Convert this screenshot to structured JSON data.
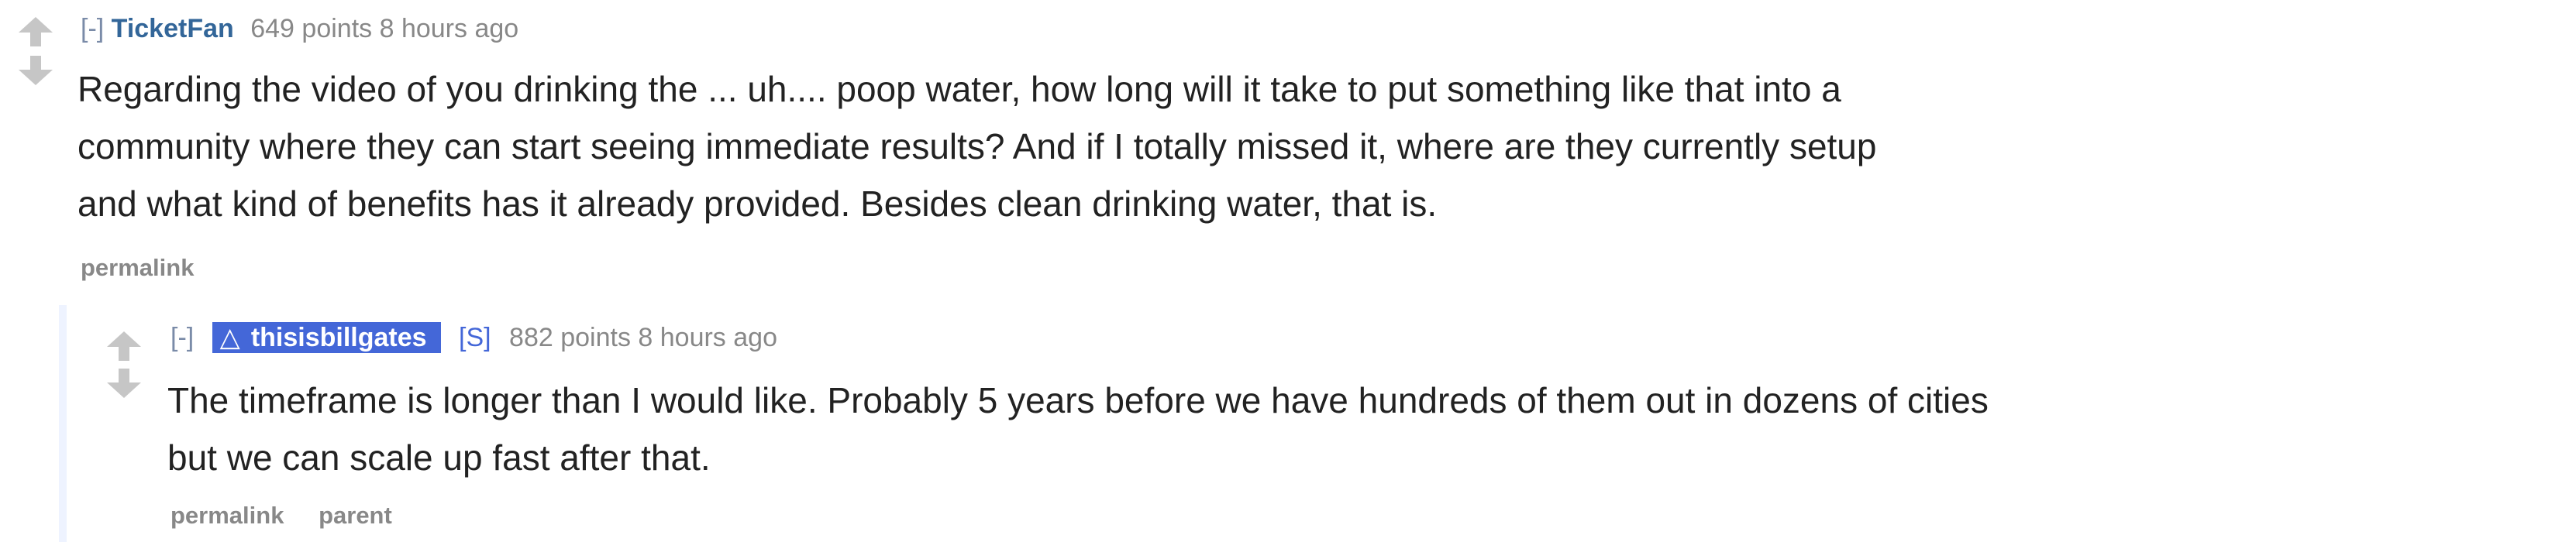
{
  "comment": {
    "expand": "[-]",
    "author": "TicketFan",
    "score": "649 points",
    "time": "8 hours ago",
    "body_lines": [
      "Regarding the video of you drinking the ... uh.... poop water, how long will it take to put something like that into a",
      "community where they can start seeing immediate results? And if I totally missed it, where are they currently setup",
      "and what kind of benefits has it already provided. Besides clean drinking water, that is."
    ],
    "permalink": "permalink"
  },
  "reply": {
    "expand": "[-]",
    "author": "thisisbillgates",
    "flair": "[S]",
    "score": "882 points",
    "time": "8 hours ago",
    "body_lines": [
      "The timeframe is longer than I would like. Probably 5 years before we have hundreds of them out in dozens of cities",
      "but we can scale up fast after that."
    ],
    "permalink": "permalink",
    "parent": "parent"
  }
}
